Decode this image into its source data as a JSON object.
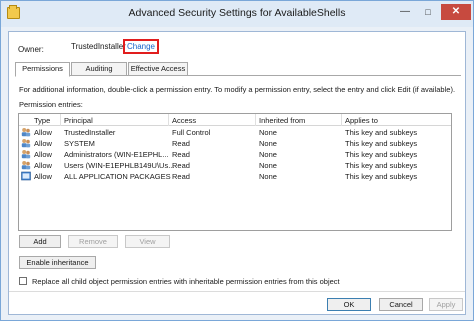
{
  "window": {
    "title": "Advanced Security Settings for AvailableShells",
    "controls": {
      "minimize": "—",
      "maximize": "□",
      "close": "✕"
    }
  },
  "owner": {
    "label": "Owner:",
    "value": "TrustedInstaller",
    "change_link": "Change",
    "highlight_color": "#e11d1d"
  },
  "tabs": [
    {
      "label": "Permissions",
      "active": true
    },
    {
      "label": "Auditing",
      "active": false
    },
    {
      "label": "Effective Access",
      "active": false
    }
  ],
  "permissions": {
    "info_text": "For additional information, double-click a permission entry. To modify a permission entry, select the entry and click Edit (if available).",
    "entries_label": "Permission entries:",
    "columns": [
      "Type",
      "Principal",
      "Access",
      "Inherited from",
      "Applies to"
    ],
    "rows": [
      {
        "icon": "user-group-icon",
        "type": "Allow",
        "principal": "TrustedInstaller",
        "access": "Full Control",
        "inherited": "None",
        "applies": "This key and subkeys"
      },
      {
        "icon": "user-group-icon",
        "type": "Allow",
        "principal": "SYSTEM",
        "access": "Read",
        "inherited": "None",
        "applies": "This key and subkeys"
      },
      {
        "icon": "user-group-icon",
        "type": "Allow",
        "principal": "Administrators (WIN-E1EPHL...",
        "access": "Read",
        "inherited": "None",
        "applies": "This key and subkeys"
      },
      {
        "icon": "user-group-icon",
        "type": "Allow",
        "principal": "Users (WIN-E1EPHLB149U\\Us...",
        "access": "Read",
        "inherited": "None",
        "applies": "This key and subkeys"
      },
      {
        "icon": "app-packages-icon",
        "type": "Allow",
        "principal": "ALL APPLICATION PACKAGES",
        "access": "Read",
        "inherited": "None",
        "applies": "This key and subkeys"
      }
    ],
    "buttons": {
      "add": "Add",
      "remove": "Remove",
      "view": "View"
    },
    "enable_inheritance": "Enable inheritance",
    "replace_checkbox_label": "Replace all child object permission entries with inheritable permission entries from this object",
    "replace_checked": false
  },
  "footer": {
    "ok": "OK",
    "cancel": "Cancel",
    "apply": "Apply"
  }
}
